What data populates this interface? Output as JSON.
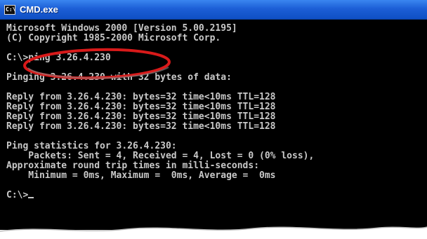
{
  "window": {
    "title": "CMD.exe",
    "icon": "cmd-icon",
    "icon_glyph": "C:\\"
  },
  "console": {
    "lines": [
      "Microsoft Windows 2000 [Version 5.00.2195]",
      "(C) Copyright 1985-2000 Microsoft Corp.",
      "",
      "C:\\>ping 3.26.4.230",
      "",
      "Pinging 3.26.4.230 with 32 bytes of data:",
      "",
      "Reply from 3.26.4.230: bytes=32 time<10ms TTL=128",
      "Reply from 3.26.4.230: bytes=32 time<10ms TTL=128",
      "Reply from 3.26.4.230: bytes=32 time<10ms TTL=128",
      "Reply from 3.26.4.230: bytes=32 time<10ms TTL=128",
      "",
      "Ping statistics for 3.26.4.230:",
      "    Packets: Sent = 4, Received = 4, Lost = 0 (0% loss),",
      "Approximate round trip times in milli-seconds:",
      "    Minimum = 0ms, Maximum =  0ms, Average =  0ms",
      "",
      "C:\\>"
    ]
  },
  "colors": {
    "titlebar": "#1c5fd6",
    "console_background": "#000000",
    "console_text": "#c9c9c9",
    "highlight_ring": "#d81a1a"
  }
}
